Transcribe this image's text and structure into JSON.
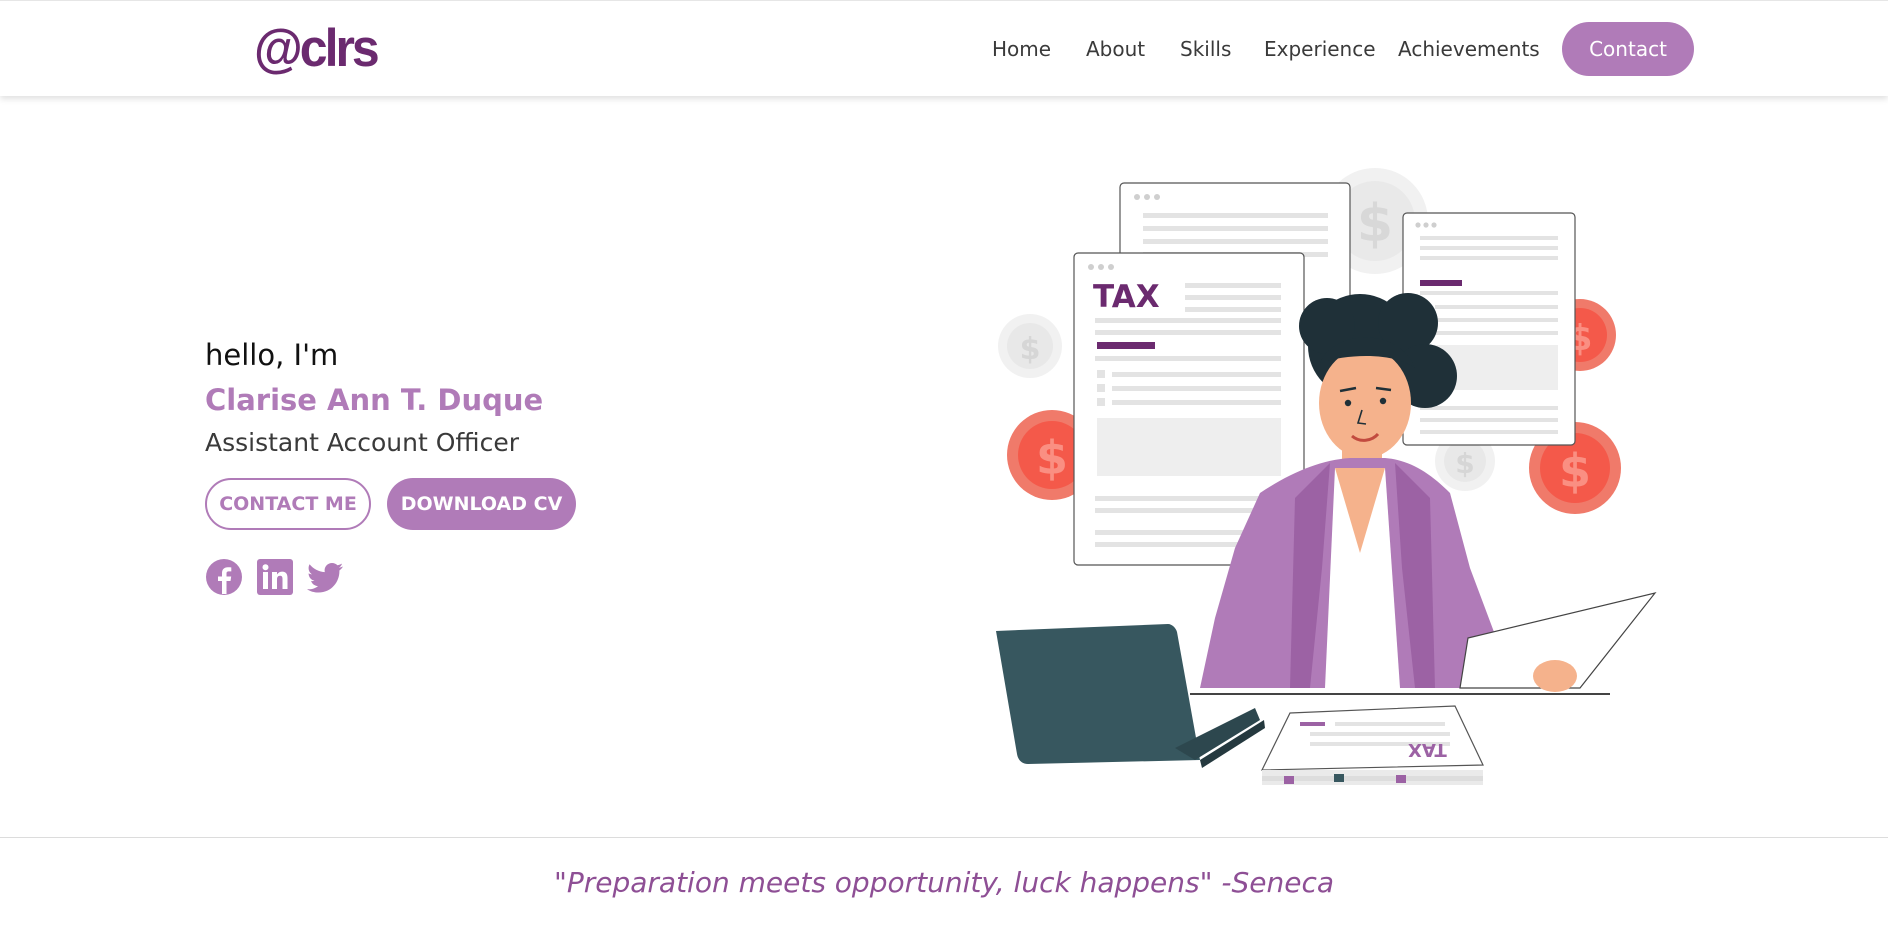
{
  "brand": {
    "logo_text": "@clrs",
    "accent_color": "#b07bb8",
    "logo_color": "#6b2a6f"
  },
  "nav": {
    "links": [
      "Home",
      "About",
      "Skills",
      "Experience",
      "Achievements"
    ],
    "contact_label": "Contact"
  },
  "hero": {
    "greeting": "hello, I'm",
    "name": "Clarise Ann T. Duque",
    "title": "Assistant Account Officer",
    "contact_button": "CONTACT ME",
    "download_button": "DOWNLOAD CV",
    "social_icons": [
      "facebook-icon",
      "linkedin-icon",
      "twitter-icon"
    ]
  },
  "illustration": {
    "tax_label": "TAX",
    "tax_label_small": "TAX"
  },
  "footer": {
    "quote": "\"Preparation meets opportunity, luck happens\" -Seneca"
  }
}
